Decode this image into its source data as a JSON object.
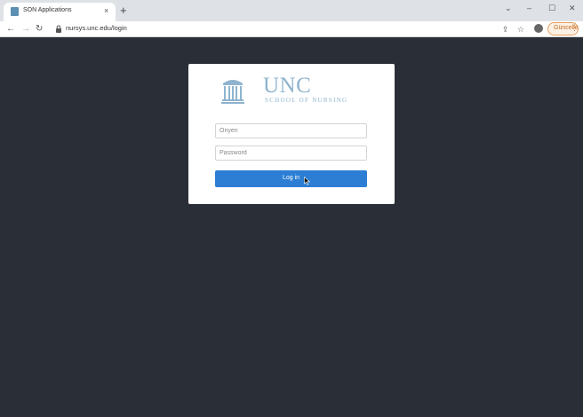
{
  "browser": {
    "tab_title": "SON Applications",
    "tab_close": "×",
    "new_tab": "+",
    "window_controls": {
      "chevron": "⌄",
      "minimize": "–",
      "maximize": "☐",
      "close": "✕"
    },
    "nav": {
      "back": "←",
      "forward": "→",
      "reload": "↻"
    },
    "url": "nursys.unc.edu/login",
    "toolbar": {
      "share": "⇪",
      "star": "☆",
      "update_label": "Güncelle",
      "update_menu": "⋮"
    },
    "icons": [
      "favicon-icon",
      "lock-icon",
      "share-icon",
      "star-icon",
      "profile-icon",
      "menu-dots-icon"
    ]
  },
  "login": {
    "logo": {
      "wordmark": "UNC",
      "subtitle": "SCHOOL OF NURSING",
      "mark": "old-well-icon",
      "color": "#8fb4cf"
    },
    "onyen_placeholder": "Onyen",
    "password_placeholder": "Password",
    "login_button": "Log in",
    "button_color": "#2b7ed4"
  },
  "page": {
    "background": "#2a2f37"
  }
}
